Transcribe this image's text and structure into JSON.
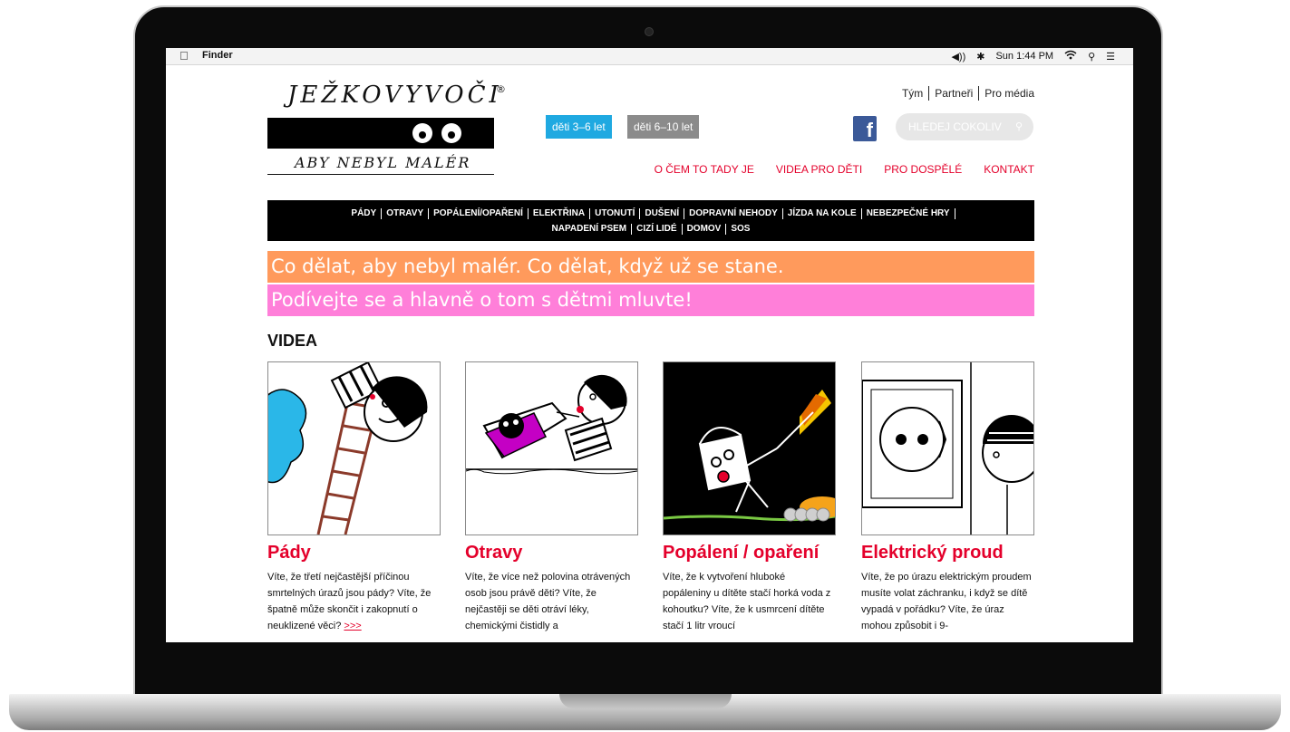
{
  "menubar": {
    "apple_icon": "",
    "app_name": "Finder",
    "volume_icon": "◀))",
    "bluetooth_icon": "✱",
    "clock": "Sun 1:44 PM",
    "wifi_icon": "wifi",
    "spotlight_icon": "⚲",
    "notification_icon": "☰"
  },
  "logo": {
    "top_text": "JEŽKOVYVOČI",
    "bottom_text": "ABY NEBYL MALÉR",
    "registered": "®"
  },
  "age_buttons": [
    {
      "label": "děti 3–6 let",
      "color": "#1fa9e1"
    },
    {
      "label": "děti 6–10 let",
      "color": "#8b8b8b"
    }
  ],
  "top_links": [
    "Tým",
    "Partneři",
    "Pro média"
  ],
  "facebook_icon": "f",
  "search": {
    "placeholder": "HLEDEJ COKOLIV"
  },
  "main_nav": [
    "O ČEM TO TADY JE",
    "VIDEA PRO DĚTI",
    "PRO DOSPĚLÉ",
    "KONTAKT"
  ],
  "categories": [
    "PÁDY",
    "OTRAVY",
    "POPÁLENÍ/OPAŘENÍ",
    "ELEKTŘINA",
    "UTONUTÍ",
    "DUŠENÍ",
    "DOPRAVNÍ NEHODY",
    "JÍZDA NA KOLE",
    "NEBEZPEČNÉ HRY",
    "NAPADENÍ PSEM",
    "CIZÍ LIDÉ",
    "DOMOV",
    "SOS"
  ],
  "banners": [
    {
      "text": "Co dělat, aby nebyl malér. Co dělat, když už se stane.",
      "color": "#ff9a5c"
    },
    {
      "text": "Podívejte se a hlavně o tom s dětmi mluvte!",
      "color": "#ff7fd9"
    }
  ],
  "videos": {
    "heading": "VIDEA",
    "items": [
      {
        "title": "Pády",
        "text": "Víte, že třetí nejčastější příčinou smrtelných úrazů jsou pády? Víte, že špatně může skončit i zakopnutí o neuklizené věci?",
        "more": ">>>"
      },
      {
        "title": "Otravy",
        "text": "Víte, že více než polovina otrávených osob jsou právě děti? Víte, že nejčastěji se děti otráví léky, chemickými čistidly a"
      },
      {
        "title": "Popálení / opaření",
        "text": "Víte, že k vytvoření hluboké popáleniny u dítěte stačí horká voda z kohoutku? Víte, že k usmrcení dítěte stačí 1 litr vroucí"
      },
      {
        "title": "Elektrický proud",
        "text": "Víte, že po úrazu elektrickým proudem musíte volat záchranku, i když se dítě vypadá v pořádku? Víte, že úraz mohou způsobit i 9-"
      }
    ]
  },
  "colors": {
    "accent_red": "#e4002b",
    "nav_black": "#000000"
  }
}
